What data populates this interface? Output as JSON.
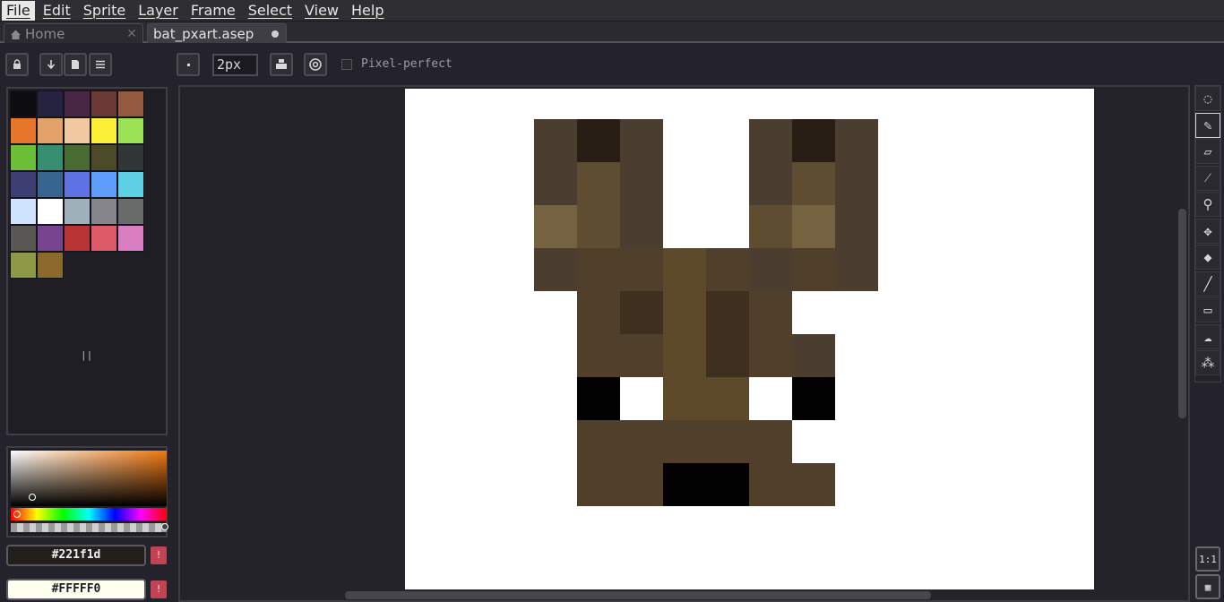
{
  "menu": {
    "items": [
      "File",
      "Edit",
      "Sprite",
      "Layer",
      "Frame",
      "Select",
      "View",
      "Help"
    ]
  },
  "tabs": {
    "home_label": "Home",
    "file_label": "bat_pxart.asep"
  },
  "toolbar": {
    "brush_size": "2px",
    "pixel_perfect_label": "Pixel-perfect",
    "pixel_perfect_checked": false
  },
  "palette": {
    "colors": [
      "#0d0c10",
      "#25233f",
      "#482745",
      "#6b3a36",
      "#945a40",
      "#e8762a",
      "#e2a26a",
      "#f1c8a0",
      "#fbf036",
      "#9be255",
      "#6cbe37",
      "#369070",
      "#4a6b33",
      "#4d4a2a",
      "#2f3836",
      "#3d3e72",
      "#366690",
      "#5f72e3",
      "#5f9dfd",
      "#5ed0e6",
      "#cfe2fe",
      "#ffffff",
      "#9eb0b9",
      "#87858c",
      "#696a6a",
      "#5a5653",
      "#77448f",
      "#b83435",
      "#dd5b68",
      "#d97ec0",
      "#8d9946",
      "#8c6a2e"
    ]
  },
  "colors": {
    "foreground": "#221f1d",
    "background": "#FFFFF0",
    "warn_glyph": "!"
  },
  "sprite": {
    "grid_rows": 9,
    "grid_cols": 8,
    "palette": {
      "a": "#4b3d30",
      "b": "#281d14",
      "c": "#5f4d32",
      "d": "#756240",
      "e": "#5d4a2b",
      "f": "#503f2a",
      "g": "#3e2f1e",
      "h": "#020202",
      "w": "#ffffff"
    },
    "rows": [
      "abawwaba",
      "acawwaca",
      "dcawwcda",
      "affefafa",
      "wfgegfww",
      "wffegfaw",
      "whweewhw",
      "wfffffww",
      "wffhhffw"
    ]
  },
  "tools": [
    {
      "name": "lasso-tool",
      "glyph": "◌"
    },
    {
      "name": "pencil-tool",
      "glyph": "✎"
    },
    {
      "name": "eraser-tool",
      "glyph": "▱"
    },
    {
      "name": "eyedropper-tool",
      "glyph": "⁄"
    },
    {
      "name": "zoom-tool",
      "glyph": "⚲"
    },
    {
      "name": "move-tool",
      "glyph": "✥"
    },
    {
      "name": "fill-tool",
      "glyph": "◆"
    },
    {
      "name": "line-tool",
      "glyph": "╱"
    },
    {
      "name": "rectangle-tool",
      "glyph": "▭"
    },
    {
      "name": "blur-tool",
      "glyph": "☁"
    },
    {
      "name": "spray-tool",
      "glyph": "⁂"
    }
  ],
  "bottom_tools": {
    "actual_size_label": "1:1",
    "timeline_glyph": "▦"
  }
}
